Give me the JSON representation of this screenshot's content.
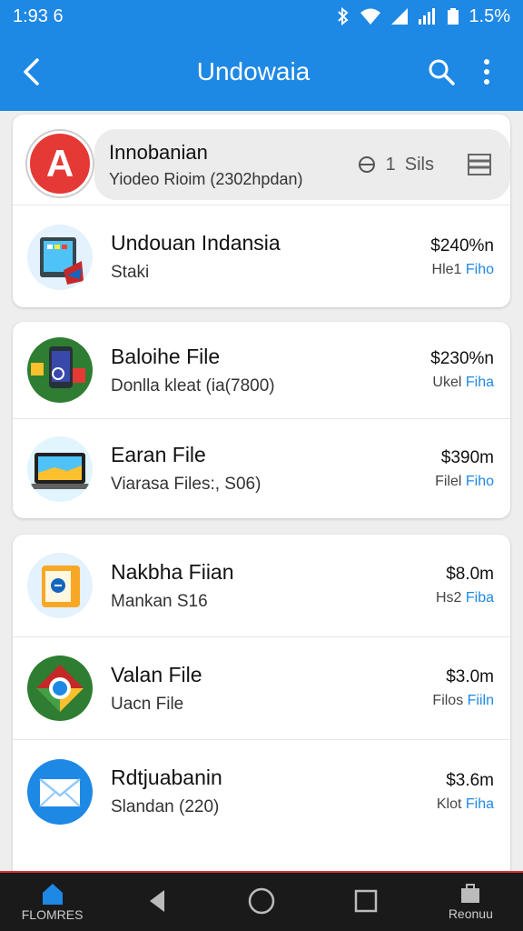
{
  "status": {
    "time": "1:93 6",
    "battery": "1.5%"
  },
  "appbar": {
    "title": "Undowaia"
  },
  "header": {
    "avatar_letter": "A",
    "title": "Innobanian",
    "subtitle": "Yiodeo Rioim (2302hpdan)",
    "filter_label": "Sils",
    "filter_prefix": "1"
  },
  "files": [
    {
      "name": "Undouan Indansia",
      "sub": "Staki",
      "size": "$240%n",
      "type": "Hle1",
      "type_accent": "Fiho"
    },
    {
      "name": "Baloihe File",
      "sub": "Donlla kleat (ia(7800)",
      "size": "$230%n",
      "type": "Ukel",
      "type_accent": "Fiha"
    },
    {
      "name": "Earan File",
      "sub": "Viarasa Files:, S06)",
      "size": "$390m",
      "type": "Filel",
      "type_accent": "Fiho"
    },
    {
      "name": "Nakbha Fiian",
      "sub": "Mankan S16",
      "size": "$8.0m",
      "type": "Hs2",
      "type_accent": "Fiba"
    },
    {
      "name": "Valan File",
      "sub": "Uacn File",
      "size": "$3.0m",
      "type": "Filos",
      "type_accent": "Fiiln"
    },
    {
      "name": "Rdtjuabanin",
      "sub": "Slandan (220)",
      "size": "$3.6m",
      "type": "Klot",
      "type_accent": "Fiha"
    }
  ],
  "nav": {
    "home_label": "FLOMRES",
    "right_label": "Reonuu"
  },
  "colors": {
    "primary": "#1e88e5",
    "red": "#e53935"
  }
}
